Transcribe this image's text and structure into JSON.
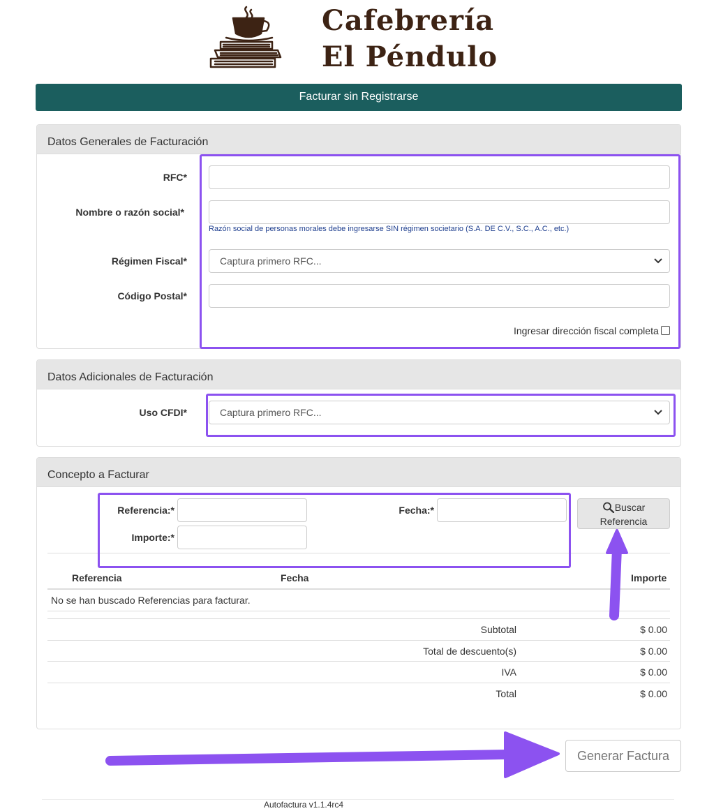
{
  "brand": {
    "line1": "Cafebrería",
    "line2": "El Péndulo",
    "logo_icon": "coffee-cup-books-icon",
    "color": "#3d2314"
  },
  "header": {
    "title": "Facturar sin Registrarse",
    "color": "#1b5e5e"
  },
  "general": {
    "heading": "Datos Generales de Facturación",
    "rfc_label": "RFC*",
    "nombre_label": "Nombre o razón social*",
    "nombre_help": "Razón social de personas morales debe ingresarse SIN régimen societario (S.A. DE C.V., S.C., A.C., etc.)",
    "regimen_label": "Régimen Fiscal*",
    "regimen_value": "Captura primero RFC...",
    "cp_label": "Código Postal*",
    "direccion_label": "Ingresar dirección fiscal completa"
  },
  "adicionales": {
    "heading": "Datos Adicionales de Facturación",
    "uso_label": "Uso CFDI*",
    "uso_value": "Captura primero RFC..."
  },
  "concepto": {
    "heading": "Concepto a Facturar",
    "referencia_label": "Referencia:*",
    "fecha_label": "Fecha:*",
    "importe_label": "Importe:*",
    "buscar_line1": "Buscar",
    "buscar_line2": "Referencia",
    "table_headers": [
      "Referencia",
      "Fecha",
      "Importe"
    ],
    "empty_message": "No se han buscado Referencias para facturar.",
    "totals": [
      {
        "label": "Subtotal",
        "value": "$ 0.00"
      },
      {
        "label": "Total de descuento(s)",
        "value": "$ 0.00"
      },
      {
        "label": "IVA",
        "value": "$ 0.00"
      },
      {
        "label": "Total",
        "value": "$ 0.00"
      }
    ]
  },
  "actions": {
    "generate_label": "Generar Factura"
  },
  "footer": {
    "version": "Autofactura v1.1.4rc4"
  },
  "annotation": {
    "color": "#8c52f0"
  }
}
